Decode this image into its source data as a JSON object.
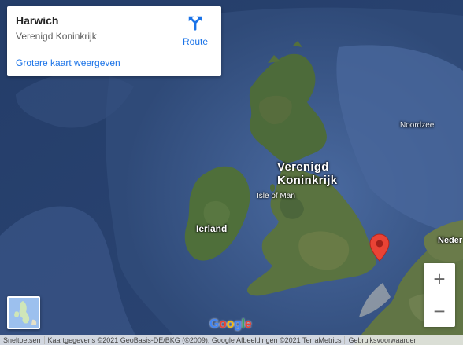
{
  "info_card": {
    "place_name": "Harwich",
    "country": "Verenigd Koninkrijk",
    "route_label": "Route",
    "bigger_map_link": "Grotere kaart weergeven"
  },
  "map_labels": {
    "uk_line1": "Verenigd",
    "uk_line2": "Koninkrijk",
    "ireland": "Ierland",
    "isle_of_man": "Isle of Man",
    "north_sea": "Noordzee",
    "netherlands_partial": "Neder"
  },
  "controls": {
    "zoom_in": "+",
    "zoom_out": "−"
  },
  "logo": "Google",
  "footer": {
    "shortcuts": "Sneltoetsen",
    "attribution": "Kaartgegevens ©2021 GeoBasis-DE/BKG (©2009), Google Afbeeldingen ©2021 TerraMetrics",
    "terms": "Gebruiksvoorwaarden"
  },
  "colors": {
    "link": "#1a73e8",
    "marker": "#ea4335",
    "ocean": "#2f4a78"
  }
}
